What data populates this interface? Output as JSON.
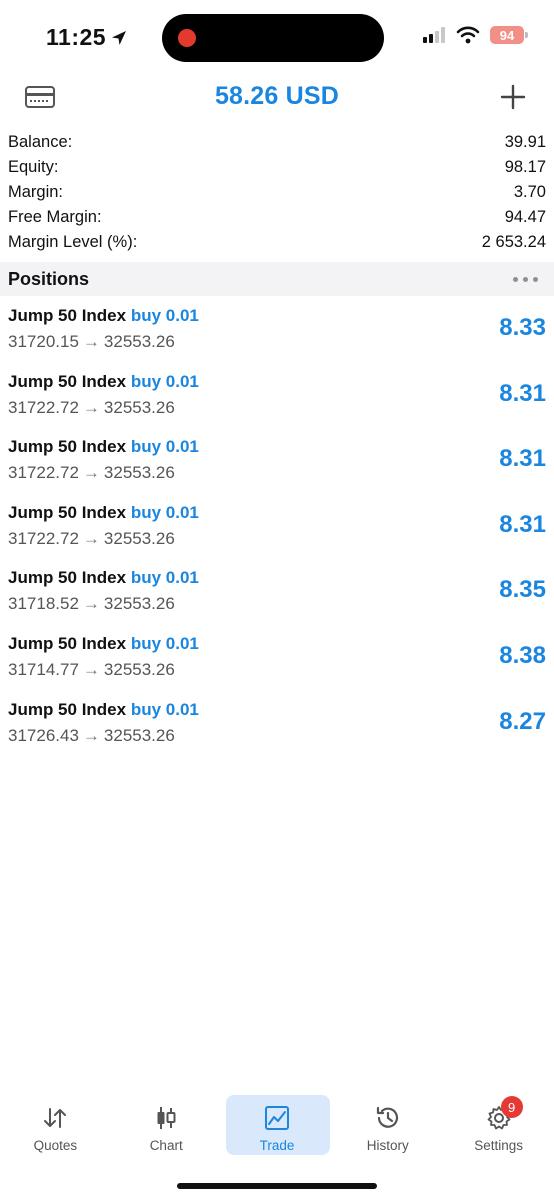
{
  "status_bar": {
    "time": "11:25",
    "battery": "94"
  },
  "header": {
    "title": "58.26 USD"
  },
  "summary": [
    {
      "label": "Balance:",
      "value": "39.91"
    },
    {
      "label": "Equity:",
      "value": "98.17"
    },
    {
      "label": "Margin:",
      "value": "3.70"
    },
    {
      "label": "Free Margin:",
      "value": "94.47"
    },
    {
      "label": "Margin Level (%):",
      "value": "2 653.24"
    }
  ],
  "positions": {
    "title": "Positions",
    "items": [
      {
        "symbol": "Jump 50 Index",
        "side": "buy 0.01",
        "open": "31720.15",
        "arrow": "→",
        "current": "32553.26",
        "profit": "8.33"
      },
      {
        "symbol": "Jump 50 Index",
        "side": "buy 0.01",
        "open": "31722.72",
        "arrow": "→",
        "current": "32553.26",
        "profit": "8.31"
      },
      {
        "symbol": "Jump 50 Index",
        "side": "buy 0.01",
        "open": "31722.72",
        "arrow": "→",
        "current": "32553.26",
        "profit": "8.31"
      },
      {
        "symbol": "Jump 50 Index",
        "side": "buy 0.01",
        "open": "31722.72",
        "arrow": "→",
        "current": "32553.26",
        "profit": "8.31"
      },
      {
        "symbol": "Jump 50 Index",
        "side": "buy 0.01",
        "open": "31718.52",
        "arrow": "→",
        "current": "32553.26",
        "profit": "8.35"
      },
      {
        "symbol": "Jump 50 Index",
        "side": "buy 0.01",
        "open": "31714.77",
        "arrow": "→",
        "current": "32553.26",
        "profit": "8.38"
      },
      {
        "symbol": "Jump 50 Index",
        "side": "buy 0.01",
        "open": "31726.43",
        "arrow": "→",
        "current": "32553.26",
        "profit": "8.27"
      }
    ]
  },
  "tabs": [
    {
      "label": "Quotes",
      "icon": "quotes-icon"
    },
    {
      "label": "Chart",
      "icon": "chart-icon"
    },
    {
      "label": "Trade",
      "icon": "trade-icon",
      "active": true
    },
    {
      "label": "History",
      "icon": "history-icon"
    },
    {
      "label": "Settings",
      "icon": "settings-icon",
      "badge": "9"
    }
  ],
  "colors": {
    "accent": "#1a86e0",
    "active_tab_bg": "#d9e9fb",
    "badge": "#e53935",
    "section_bg": "#f3f3f5"
  }
}
